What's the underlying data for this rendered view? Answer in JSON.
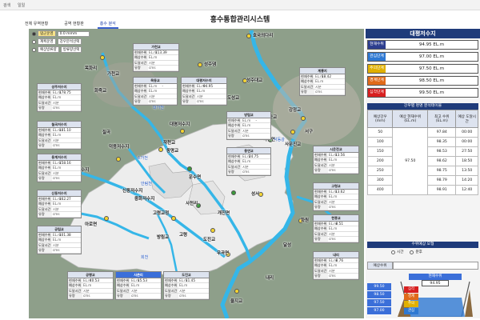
{
  "topbar": {
    "left": "검색",
    "mid": "일일"
  },
  "title": "홍수통합관리시스템",
  "tabs": [
    "전체 유역현황",
    "공역 현황판",
    "홍수 분석"
  ],
  "options": [
    {
      "label": "댐군운영",
      "value": "0.0 mmm",
      "selected": true
    },
    {
      "label": "계획운영",
      "value": "강우분석선택",
      "selected": false
    },
    {
      "label": "예상방류량",
      "value": "방류량선택",
      "selected": false
    }
  ],
  "panel_rows": [
    "현재수위",
    "예상수위",
    "도달시간",
    "유량"
  ],
  "panel_units": [
    "EL.m",
    "EL.m",
    "시분",
    "cms"
  ],
  "panels": [
    {
      "name": "가천교",
      "cur": "113.39"
    },
    {
      "name": "목동교",
      "cur": "-"
    },
    {
      "name": "대평저수지",
      "cur": "94.95"
    },
    {
      "name": "계룡지",
      "cur": "18.42"
    },
    {
      "name": "성주저수지",
      "cur": "178.75"
    },
    {
      "name": "칠곡저수지",
      "cur": "181.10"
    },
    {
      "name": "용계저수지",
      "cur": "158.16"
    },
    {
      "name": "신동저수지",
      "cur": "162.27"
    },
    {
      "name": "방림교",
      "cur": "-"
    },
    {
      "name": "용연교",
      "cur": "24.75"
    },
    {
      "name": "시운전교",
      "cur": "13.56"
    },
    {
      "name": "고령교",
      "cur": "13.62"
    },
    {
      "name": "현풍교",
      "cur": "8.51"
    },
    {
      "name": "내리",
      "cur": "8.76"
    },
    {
      "name": "공림교",
      "cur": "101.38"
    },
    {
      "name": "공평교",
      "cur": "40.53"
    },
    {
      "name": "사촌리",
      "cur": "15.53"
    },
    {
      "name": "도진교",
      "cur": "11.45"
    }
  ],
  "map_labels": {
    "places": [
      "호국의다리",
      "성주댐",
      "목화리",
      "가천교",
      "성주",
      "화죽교",
      "성주대교",
      "도성교",
      "왜관교",
      "성주천",
      "칠곡",
      "대평저수지",
      "작천교",
      "신동저수지",
      "석전리",
      "동명교",
      "운수면",
      "덕용저수지",
      "용계저수지",
      "중화저수지",
      "고령교정",
      "사천리",
      "개진면",
      "고령",
      "도진교",
      "우곡면",
      "고령교",
      "다산면",
      "서구",
      "강정교",
      "사문진교",
      "성서",
      "달성",
      "화원",
      "현풍",
      "아로면",
      "방림교",
      "공림교",
      "내리",
      "율지교",
      "쌍림면"
    ],
    "rivers": [
      "낙동강",
      "회천",
      "대가천",
      "소가천",
      "안림천",
      "백천"
    ]
  },
  "right": {
    "title": "대평저수지",
    "levels": [
      {
        "name": "현재수위",
        "value": "94.95 EL.m",
        "color": "#2d3e8f"
      },
      {
        "name": "관심단계",
        "value": "97.00 EL.m",
        "color": "#2e78d2"
      },
      {
        "name": "주의단계",
        "value": "97.50 EL.m",
        "color": "#e0b000"
      },
      {
        "name": "경계단계",
        "value": "98.50 EL.m",
        "color": "#e06a1a"
      },
      {
        "name": "심각단계",
        "value": "99.50 EL.m",
        "color": "#d72020"
      }
    ],
    "analysis_title": "강우별 명명 분석테이블",
    "analysis_headers": [
      "예상강우 (mm)",
      "예상 현재수위 (EL.m)",
      "최고 수위 (EL.m)",
      "예상 도달시간"
    ],
    "analysis_current": "97.50",
    "analysis_rows": [
      {
        "rain": "50",
        "max": "97.84",
        "time": "00:00"
      },
      {
        "rain": "100",
        "max": "98.35",
        "time": "00:00"
      },
      {
        "rain": "150",
        "max": "98.53",
        "time": "27:50"
      },
      {
        "rain": "200",
        "max": "98.62",
        "time": "18:50"
      },
      {
        "rain": "250",
        "max": "98.75",
        "time": "13:50"
      },
      {
        "rain": "300",
        "max": "98.79",
        "time": "14:20"
      },
      {
        "rain": "400",
        "max": "98.91",
        "time": "12:40"
      }
    ],
    "forecast_title": "수위예상 모형",
    "forecast_options": [
      {
        "label": "시간",
        "selected": false
      },
      {
        "label": "분후",
        "selected": false
      }
    ],
    "forecast_label": "예상수위",
    "scale": [
      "99.50",
      "98.50",
      "97.50",
      "97.00"
    ],
    "dam_caption": "현재수위",
    "dam_value": "94.95",
    "dam_levels": [
      "심각",
      "경계",
      "주의",
      "관심"
    ]
  }
}
